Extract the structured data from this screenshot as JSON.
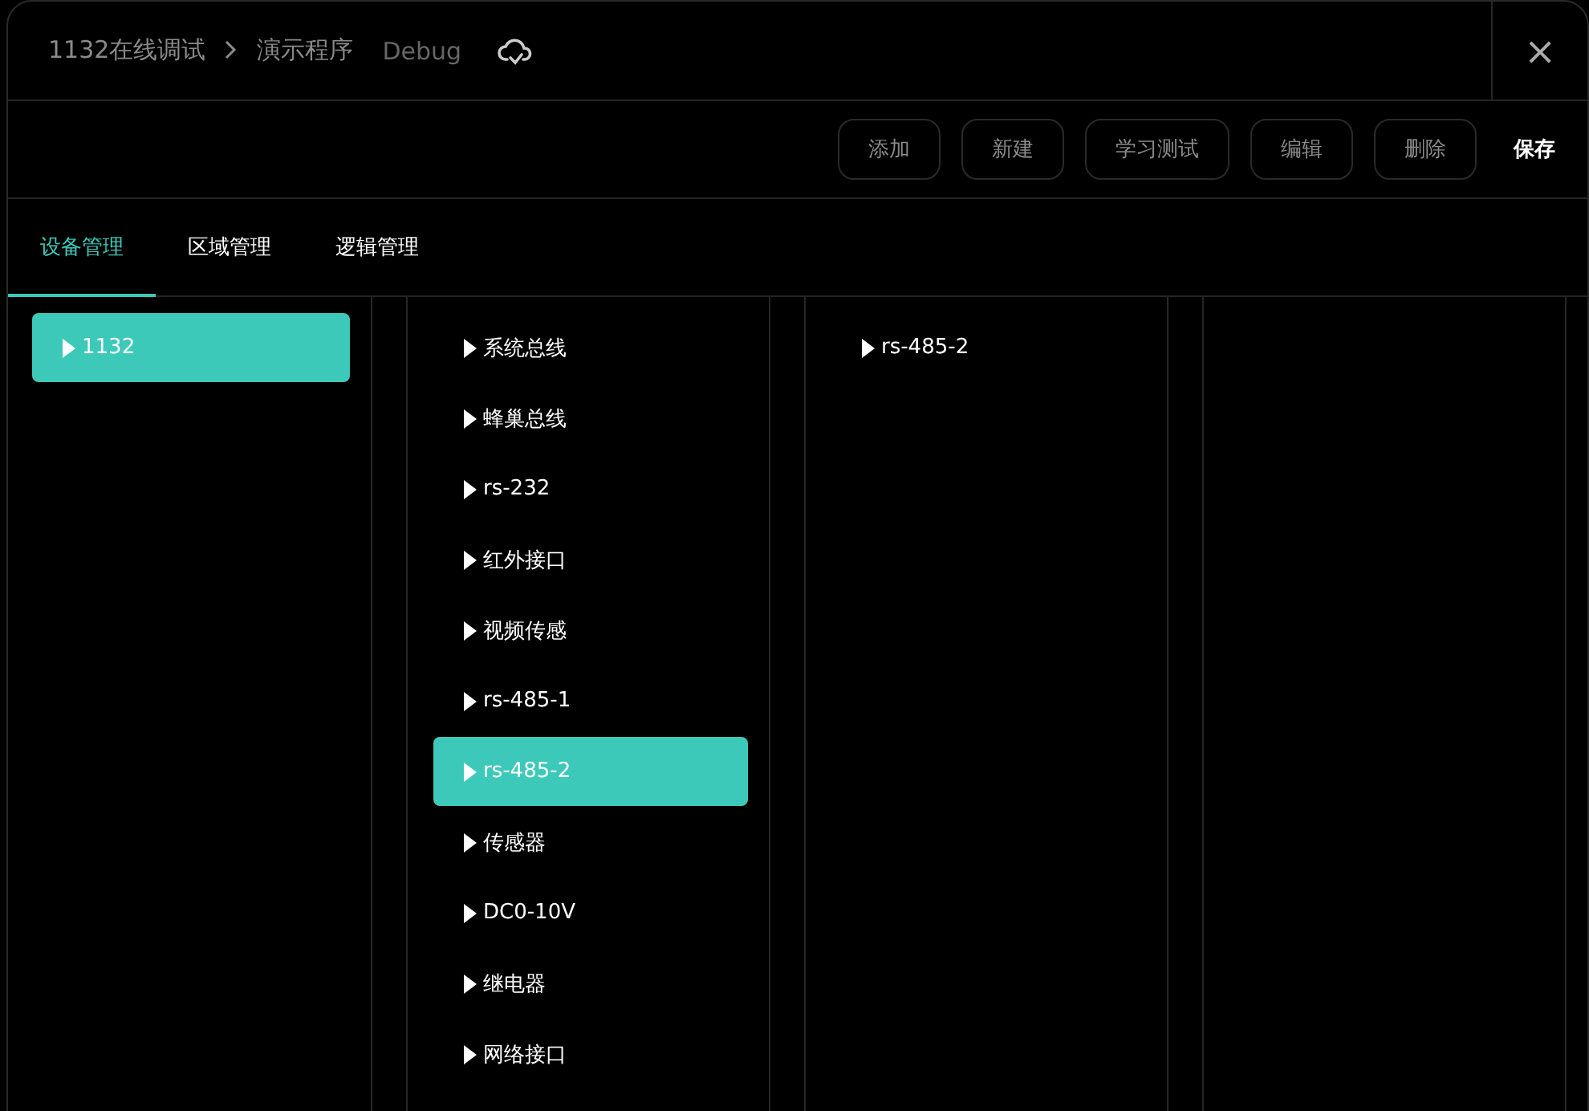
{
  "header": {
    "breadcrumb": [
      "1132在线调试",
      "演示程序"
    ],
    "mode": "Debug",
    "close": "×"
  },
  "toolbar": {
    "buttons": [
      {
        "label": "添加",
        "kind": "outline"
      },
      {
        "label": "新建",
        "kind": "outline"
      },
      {
        "label": "学习测试",
        "kind": "outline"
      },
      {
        "label": "编辑",
        "kind": "outline"
      },
      {
        "label": "删除",
        "kind": "outline"
      },
      {
        "label": "保存",
        "kind": "plain"
      }
    ]
  },
  "tabs": [
    {
      "label": "设备管理",
      "selected": true
    },
    {
      "label": "区域管理",
      "selected": false
    },
    {
      "label": "逻辑管理",
      "selected": false
    }
  ],
  "columns": [
    {
      "items": [
        {
          "label": "1132",
          "selected": true
        }
      ]
    },
    {
      "items": [
        {
          "label": "系统总线",
          "selected": false
        },
        {
          "label": "蜂巢总线",
          "selected": false
        },
        {
          "label": "rs-232",
          "selected": false
        },
        {
          "label": "红外接口",
          "selected": false
        },
        {
          "label": "视频传感",
          "selected": false
        },
        {
          "label": "rs-485-1",
          "selected": false
        },
        {
          "label": "rs-485-2",
          "selected": true
        },
        {
          "label": "传感器",
          "selected": false
        },
        {
          "label": "DC0-10V",
          "selected": false
        },
        {
          "label": "继电器",
          "selected": false
        },
        {
          "label": "网络接口",
          "selected": false
        }
      ]
    },
    {
      "items": [
        {
          "label": "rs-485-2",
          "selected": false
        }
      ]
    }
  ]
}
